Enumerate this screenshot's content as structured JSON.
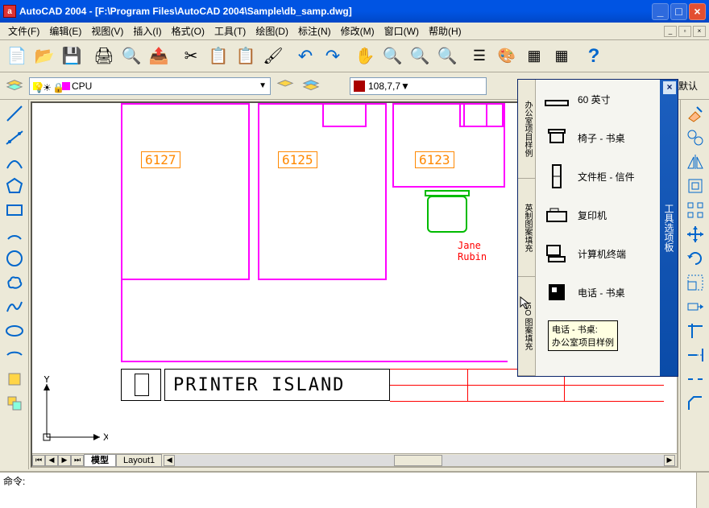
{
  "window": {
    "title": "AutoCAD 2004 - [F:\\Program Files\\AutoCAD 2004\\Sample\\db_samp.dwg]",
    "app_icon_letter": "a"
  },
  "menu": {
    "items": [
      "文件(F)",
      "编辑(E)",
      "视图(V)",
      "插入(I)",
      "格式(O)",
      "工具(T)",
      "绘图(D)",
      "标注(N)",
      "修改(M)",
      "窗口(W)",
      "帮助(H)"
    ]
  },
  "layer": {
    "current": "CPU"
  },
  "color": {
    "current": "108,7,7"
  },
  "linetype": {
    "default": "默认"
  },
  "drawing": {
    "rooms": [
      "6127",
      "6125",
      "6123"
    ],
    "annotation": "Jane\nRubin",
    "footer_label": "PRINTER ISLAND",
    "axis": {
      "x": "X",
      "y": "Y"
    }
  },
  "palette": {
    "title": "工具选项板",
    "tabs": [
      "办公室项目样例",
      "英制图案填充",
      "ISO 图案填充"
    ],
    "items": [
      "60 英寸",
      "椅子 - 书桌",
      "文件柜 - 信件",
      "复印机",
      "计算机终端",
      "电话 - 书桌"
    ],
    "tooltip": "电话 - 书桌:\n办公室项目样例"
  },
  "tabs": {
    "model": "模型",
    "layouts": [
      "Layout1"
    ]
  },
  "cmd": {
    "prompt": "命令:"
  }
}
